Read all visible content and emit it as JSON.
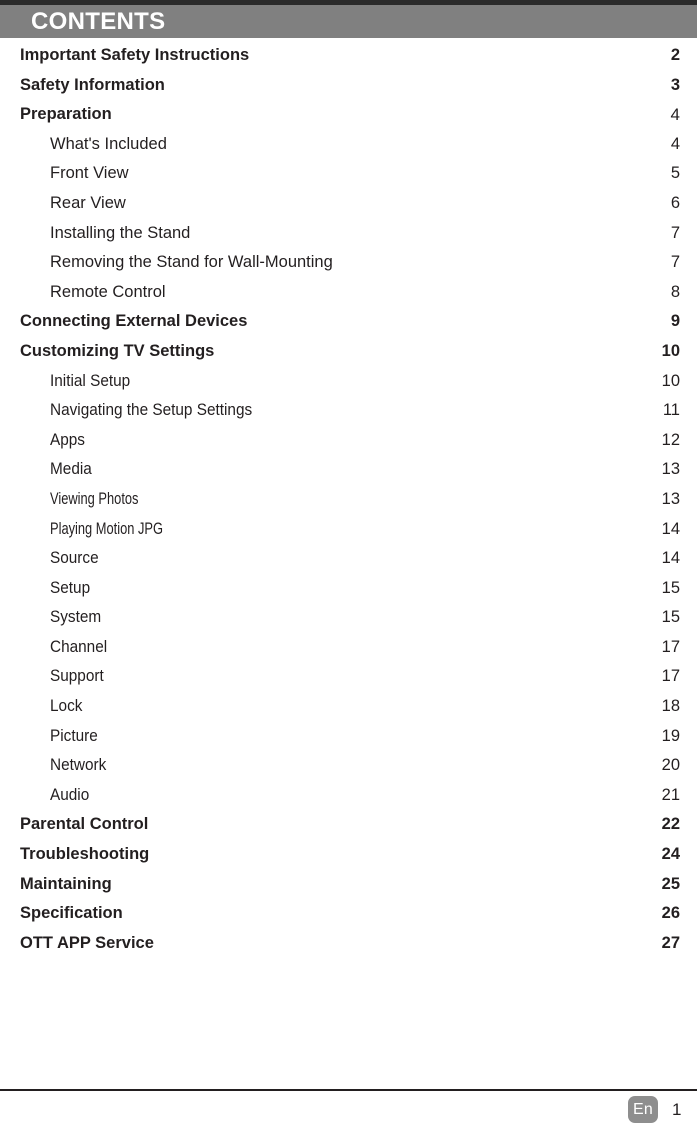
{
  "header": {
    "title": "CONTENTS",
    "band_color": "#808080",
    "strip_color": "#2b2b2b",
    "title_color": "#ffffff"
  },
  "contents": [
    {
      "label": "Important Safety Instructions",
      "page": "2",
      "level": 1,
      "style": "normal",
      "page_weight": "bold"
    },
    {
      "label": "Safety Information",
      "page": "3",
      "level": 1,
      "style": "normal",
      "page_weight": "bold"
    },
    {
      "label": "Preparation",
      "page": "4",
      "level": 1,
      "style": "normal",
      "page_weight": "regular"
    },
    {
      "label": "What's Included",
      "page": "4",
      "level": 2,
      "style": "normal",
      "page_weight": "regular"
    },
    {
      "label": "Front View",
      "page": "5",
      "level": 2,
      "style": "normal",
      "page_weight": "regular"
    },
    {
      "label": "Rear View",
      "page": "6",
      "level": 2,
      "style": "normal",
      "page_weight": "regular"
    },
    {
      "label": "Installing the Stand",
      "page": "7",
      "level": 2,
      "style": "normal",
      "page_weight": "regular"
    },
    {
      "label": "Removing the Stand for Wall-Mounting",
      "page": "7",
      "level": 2,
      "style": "normal",
      "page_weight": "regular"
    },
    {
      "label": "Remote Control",
      "page": "8",
      "level": 2,
      "style": "normal",
      "page_weight": "regular"
    },
    {
      "label": "Connecting External Devices",
      "page": "9",
      "level": 1,
      "style": "normal",
      "page_weight": "bold"
    },
    {
      "label": "Customizing TV Settings",
      "page": "10",
      "level": 1,
      "style": "normal",
      "page_weight": "bold"
    },
    {
      "label": "Initial Setup",
      "page": "10",
      "level": 2,
      "style": "narrow",
      "page_weight": "regular"
    },
    {
      "label": "Navigating the Setup Settings",
      "page": "11",
      "level": 2,
      "style": "narrow",
      "page_weight": "regular"
    },
    {
      "label": "Apps",
      "page": "12",
      "level": 2,
      "style": "narrow",
      "page_weight": "regular"
    },
    {
      "label": "Media",
      "page": "13",
      "level": 2,
      "style": "narrow",
      "page_weight": "regular"
    },
    {
      "label": "Viewing Photos",
      "page": "13",
      "level": 2,
      "style": "condensed",
      "page_weight": "regular"
    },
    {
      "label": "Playing Motion JPG",
      "page": "14",
      "level": 2,
      "style": "condensed",
      "page_weight": "regular"
    },
    {
      "label": "Source",
      "page": "14",
      "level": 2,
      "style": "narrow",
      "page_weight": "regular"
    },
    {
      "label": "Setup",
      "page": "15",
      "level": 2,
      "style": "narrow",
      "page_weight": "regular"
    },
    {
      "label": "System",
      "page": "15",
      "level": 2,
      "style": "narrow",
      "page_weight": "regular"
    },
    {
      "label": "Channel",
      "page": "17",
      "level": 2,
      "style": "narrow",
      "page_weight": "regular"
    },
    {
      "label": "Support",
      "page": "17",
      "level": 2,
      "style": "narrow",
      "page_weight": "regular"
    },
    {
      "label": "Lock",
      "page": "18",
      "level": 2,
      "style": "narrow",
      "page_weight": "regular"
    },
    {
      "label": "Picture",
      "page": "19",
      "level": 2,
      "style": "narrow",
      "page_weight": "regular"
    },
    {
      "label": "Network",
      "page": "20",
      "level": 2,
      "style": "narrow",
      "page_weight": "regular"
    },
    {
      "label": "Audio",
      "page": "21",
      "level": 2,
      "style": "narrow",
      "page_weight": "regular"
    },
    {
      "label": "Parental Control",
      "page": "22",
      "level": 1,
      "style": "normal",
      "page_weight": "bold"
    },
    {
      "label": "Troubleshooting",
      "page": "24",
      "level": 1,
      "style": "normal",
      "page_weight": "bold"
    },
    {
      "label": "Maintaining",
      "page": "25",
      "level": 1,
      "style": "normal",
      "page_weight": "bold"
    },
    {
      "label": "Specification",
      "page": "26",
      "level": 1,
      "style": "normal",
      "page_weight": "bold"
    },
    {
      "label": "OTT APP Service",
      "page": "27",
      "level": 1,
      "style": "normal",
      "page_weight": "bold"
    }
  ],
  "footer": {
    "language_badge": "En",
    "page_number": "1",
    "badge_color": "#8e8e8e",
    "rule_color": "#231f20"
  }
}
